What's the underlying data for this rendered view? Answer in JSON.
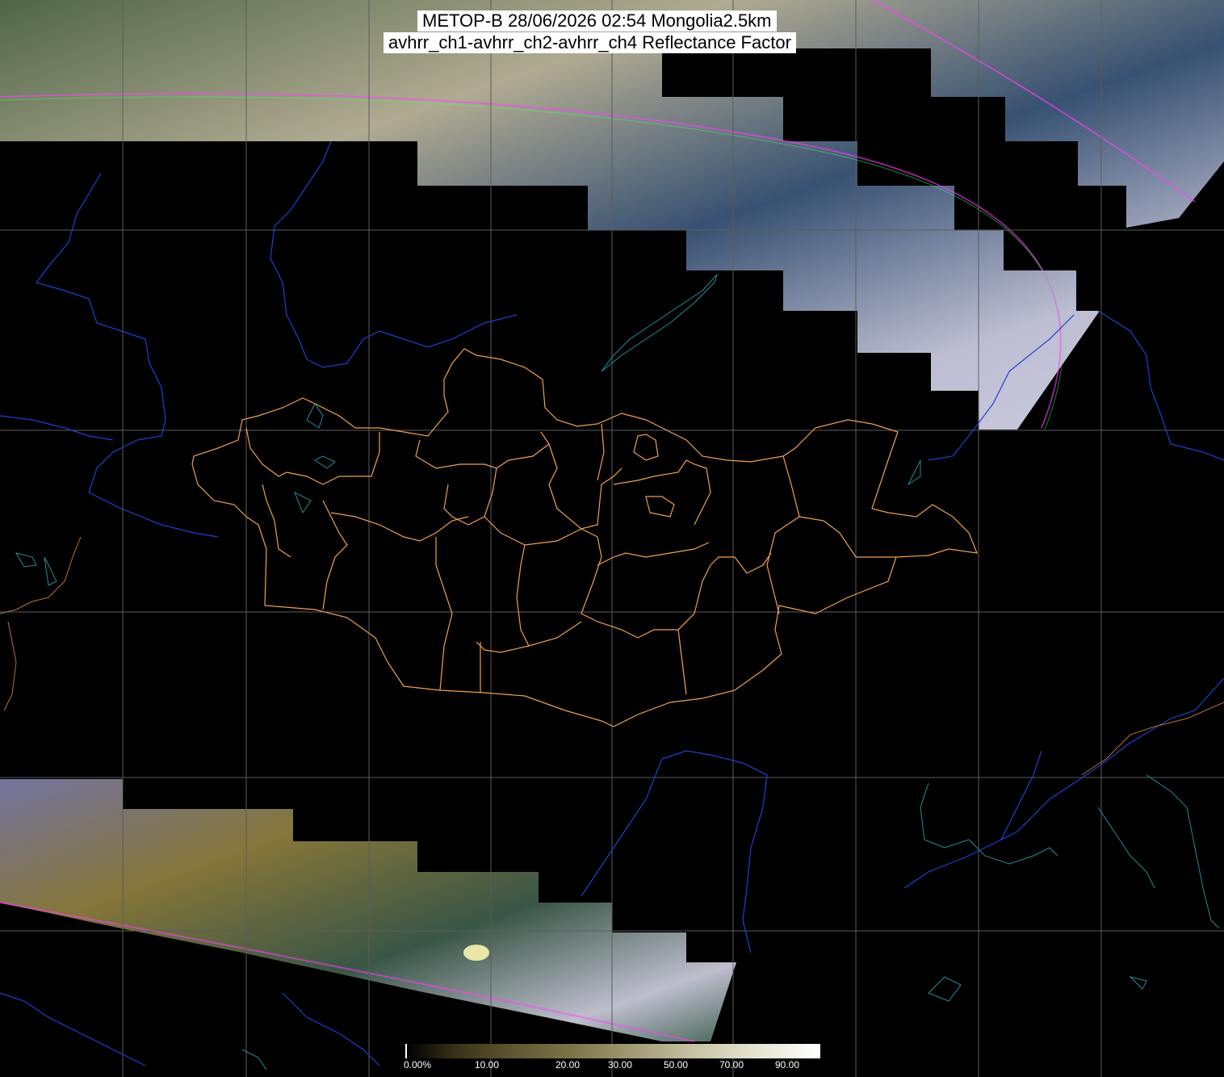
{
  "title": {
    "line1": "METOP-B 28/06/2026 02:54 Mongolia2.5km",
    "line2": "avhrr_ch1-avhrr_ch2-avhrr_ch4 Reflectance Factor"
  },
  "colorbar": {
    "labels": [
      "0.00%",
      "10.00",
      "20.00",
      "30.00",
      "50.00",
      "70.00",
      "90.00"
    ]
  },
  "colors": {
    "background": "#000000",
    "province_border": "#f0a050",
    "rivers": "#2040d0",
    "coastline": "#2a8a9a",
    "graticule": "#606060"
  }
}
